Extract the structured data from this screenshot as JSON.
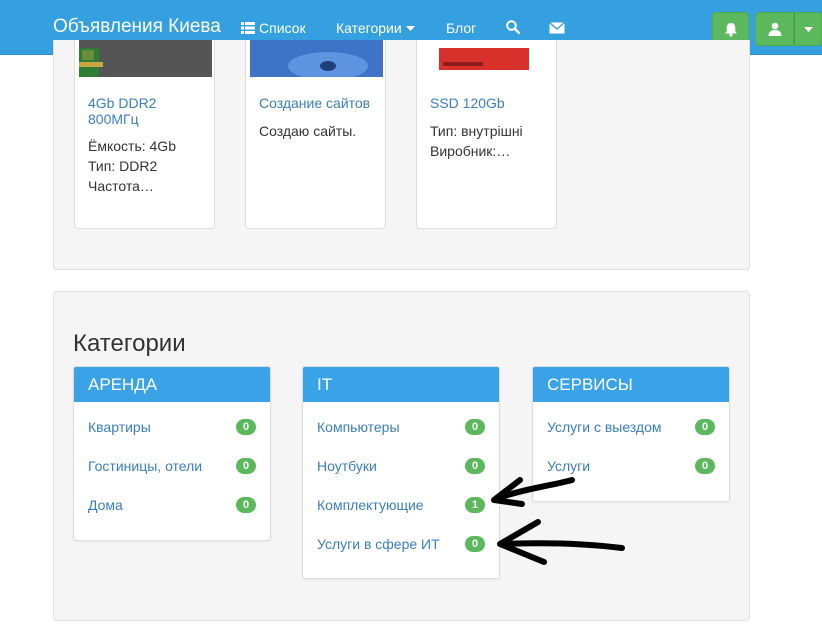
{
  "navbar": {
    "brand": "Объявления Киева",
    "list_label": "Список",
    "categories_label": "Категории",
    "blog_label": "Блог"
  },
  "listings": [
    {
      "title": "4Gb DDR2 800МГц",
      "desc": [
        "Ёмкость: 4Gb",
        "Тип: DDR2",
        "Частота…"
      ]
    },
    {
      "title": "Создание сайтов",
      "desc": [
        "Создаю сайты."
      ]
    },
    {
      "title": "SSD 120Gb",
      "desc": [
        "Тип: внутрішні",
        "Виробник:…"
      ]
    }
  ],
  "categories_section": {
    "title": "Категории",
    "groups": [
      {
        "name": "АРЕНДА",
        "items": [
          {
            "label": "Квартиры",
            "count": "0"
          },
          {
            "label": "Гостиницы, отели",
            "count": "0"
          },
          {
            "label": "Дома",
            "count": "0"
          }
        ]
      },
      {
        "name": "IT",
        "items": [
          {
            "label": "Компьютеры",
            "count": "0"
          },
          {
            "label": "Ноутбуки",
            "count": "0"
          },
          {
            "label": "Комплектующие",
            "count": "1"
          },
          {
            "label": "Услуги в сфере ИТ",
            "count": "0"
          }
        ]
      },
      {
        "name": "СЕРВИСЫ",
        "items": [
          {
            "label": "Услуги с выездом",
            "count": "0"
          },
          {
            "label": "Услуги",
            "count": "0"
          }
        ]
      }
    ]
  },
  "colors": {
    "navbar": "#34a0e0",
    "category_header": "#3aa2e6",
    "badge": "#5cb85c",
    "link": "#3a7ec2"
  }
}
